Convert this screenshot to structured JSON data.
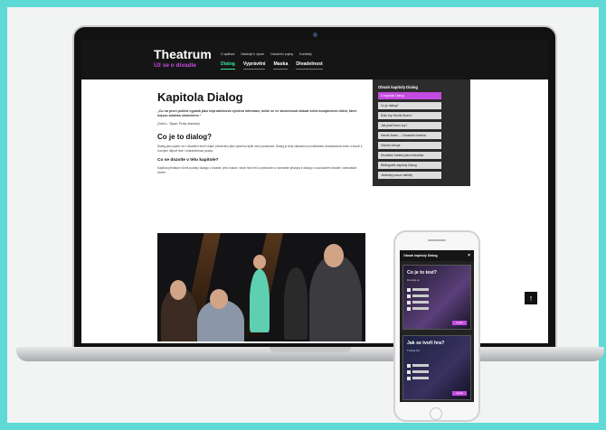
{
  "site": {
    "logo": "Theatrum",
    "tagline": "Už se o divadle",
    "top_links": [
      "O aplikaci",
      "Nástroje k výuce",
      "Divadelní pojmy",
      "Kontakty"
    ],
    "main_tabs": [
      {
        "label": "Dialog",
        "active": true
      },
      {
        "label": "Vyprávění",
        "active": false
      },
      {
        "label": "Maska",
        "active": false
      },
      {
        "label": "Divadelnost",
        "active": false
      }
    ]
  },
  "content": {
    "title": "Kapitola Dialog",
    "lead": "„Co na první pohled vypadá jako neproblémová výměna informací, může se ve skutečnosti ukázat velmi komplexním dílem, které nejsou zdaleka ohraničené.“",
    "author": "(John L. Styan: Prvky dramatu)",
    "h2": "Co je to dialog?",
    "para1": "Dialog jako pojem se v divadelní teorii chápe především jako výměna replik mezi postavami. Dialog je tedy základním prostředkem dramatického textu a slouží k rozvíjení dějové linie i charakterizaci postav.",
    "h3": "Co se dozvíte v této kapitole?",
    "para2": "Kapitola představí různé podoby dialogu v divadle, jeho funkce, vztah mezi řečí a jednáním a rozmanité přístupy k dialogu v současném divadle i dramatické tvorbě."
  },
  "sidebar": {
    "title": "Obsah kapitoly Dialog",
    "items": [
      {
        "label": "O kapitole Dialog",
        "active": true
      },
      {
        "label": "Co je dialog?",
        "active": false
      },
      {
        "label": "Role hry Henrik Ibsen?",
        "active": false
      },
      {
        "label": "Jak psal Ibsen hry?",
        "active": false
      },
      {
        "label": "Henrik Ibsen — Divadelní kariéra",
        "active": false
      },
      {
        "label": "Všední věnuje",
        "active": false
      },
      {
        "label": "Divadelní kariéra jako metodika",
        "active": false
      },
      {
        "label": "Bibliografie kapitoly Dialog",
        "active": false
      },
      {
        "label": "Jednotky pouze aktivity",
        "active": false
      }
    ]
  },
  "scroll_top_icon": "arrow-up-icon",
  "phone": {
    "header": "Obsah kapitoly Dialog",
    "cards": [
      {
        "title": "Co je to test?",
        "sub": "Dozvěte se",
        "button": "spustit"
      },
      {
        "title": "Jak se tvoří hra?",
        "sub": "Tvořivá hra",
        "button": "spustit"
      }
    ]
  },
  "colors": {
    "accent_green": "#3de39b",
    "accent_purple": "#c44be0",
    "header_bg": "#151515",
    "backdrop": "#5fd9d6"
  }
}
